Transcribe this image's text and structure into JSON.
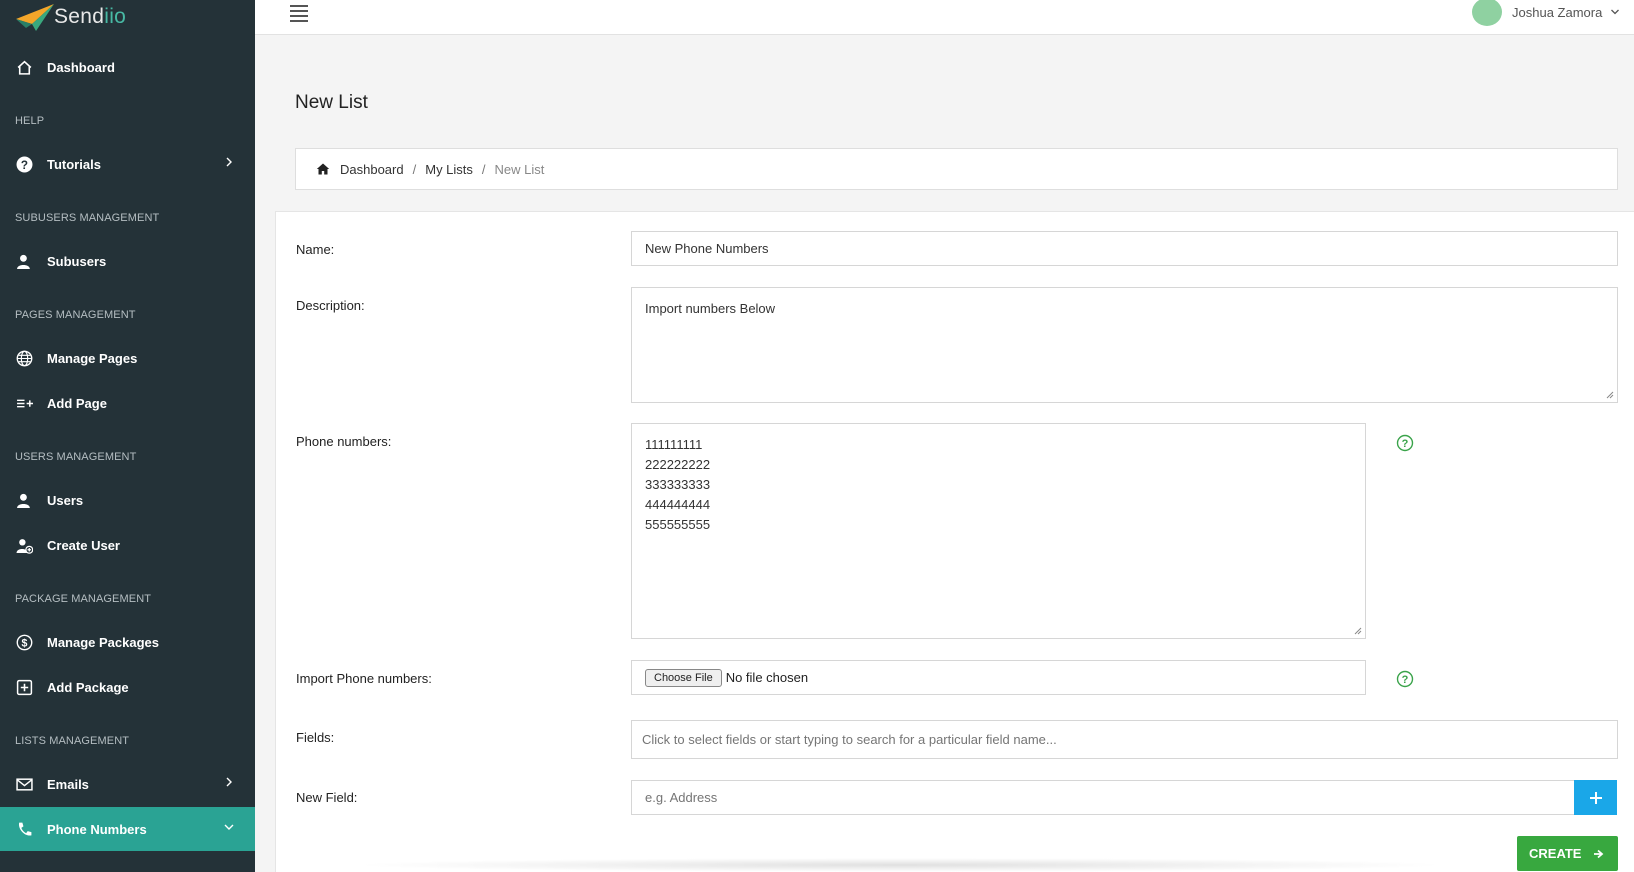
{
  "app": {
    "logo_text_main": "Send",
    "logo_text_accent": "iio"
  },
  "colors": {
    "sidebar_bg": "#243238",
    "active_item": "#2aa394",
    "create_button": "#38a83f",
    "add_field_button": "#1aa7e8"
  },
  "sidebar": {
    "dashboard": "Dashboard",
    "help_section": "HELP",
    "tutorials": "Tutorials",
    "subusers_section": "SUBUSERS MANAGEMENT",
    "subusers": "Subusers",
    "pages_section": "PAGES MANAGEMENT",
    "manage_pages": "Manage Pages",
    "add_page": "Add Page",
    "users_section": "USERS MANAGEMENT",
    "users": "Users",
    "create_user": "Create User",
    "package_section": "PACKAGE MANAGEMENT",
    "manage_packages": "Manage Packages",
    "add_package": "Add Package",
    "lists_section": "LISTS MANAGEMENT",
    "emails": "Emails",
    "phone_numbers": "Phone Numbers"
  },
  "header": {
    "user_name": "Joshua Zamora"
  },
  "page": {
    "title": "New List"
  },
  "breadcrumb": {
    "home": "Dashboard",
    "lists": "My Lists",
    "current": "New List",
    "separator": "/"
  },
  "form": {
    "name_label": "Name:",
    "name_value": "New Phone Numbers",
    "description_label": "Description:",
    "description_value": "Import numbers Below",
    "phones_label": "Phone numbers:",
    "phones_value": "111111111\n222222222\n333333333\n444444444\n555555555",
    "import_label": "Import Phone numbers:",
    "choose_file": "Choose File",
    "file_status": "No file chosen",
    "fields_label": "Fields:",
    "fields_placeholder": "Click to select fields or start typing to search for a particular field name...",
    "new_field_label": "New Field:",
    "new_field_placeholder": "e.g. Address",
    "create_button": "CREATE"
  }
}
